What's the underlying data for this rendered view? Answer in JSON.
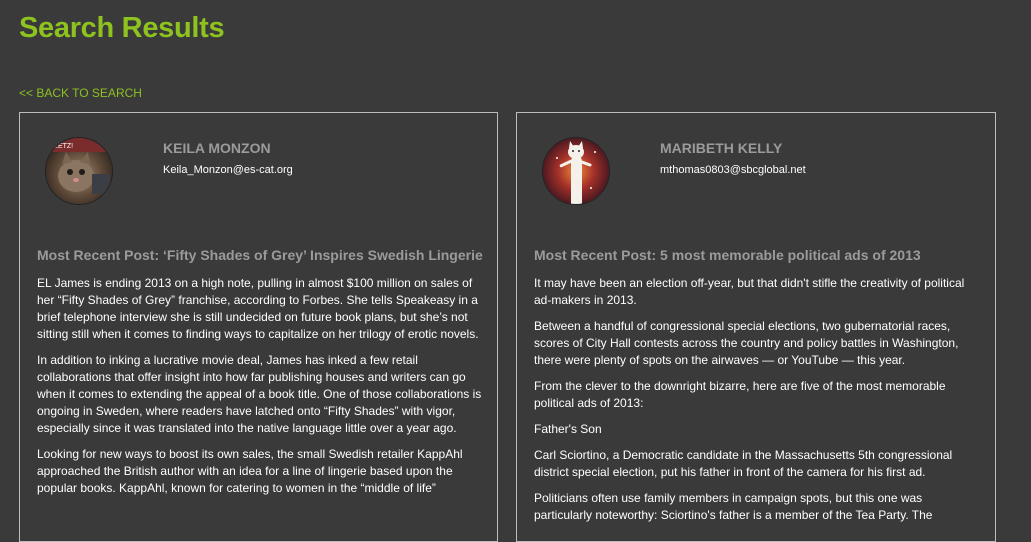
{
  "page": {
    "title": "Search Results",
    "back_label": "<< BACK TO SEARCH"
  },
  "colors": {
    "accent": "#8dc21f",
    "background": "#3a3a3b",
    "muted": "#9b9b9b",
    "border": "#bdbdbd"
  },
  "results": [
    {
      "name": "KEILA MONZON",
      "email": "Keila_Monzon@es-cat.org",
      "avatar_icon": "kitten-avatar",
      "post_title": "Most Recent Post: ‘Fifty Shades of Grey’ Inspires Swedish Lingerie",
      "paragraphs": [
        "EL James is ending 2013 on a high note, pulling in almost $100 million on sales of her “Fifty Shades of Grey” franchise, according to Forbes. She tells Speakeasy in a brief telephone interview she is still undecided on future book plans, but she’s not sitting still when it comes to finding ways to capitalize on her trilogy of erotic novels.",
        "In addition to inking a lucrative movie deal, James has inked a few retail collaborations that offer insight into how far publishing houses and writers can go when it comes to extending the appeal of a book title. One of those collaborations is ongoing in Sweden, where readers have latched onto “Fifty Shades” with vigor, especially since it was translated into the native language little over a year ago.",
        "Looking for new ways to boost its own sales, the small Swedish retailer KappAhl approached the British author with an idea for a line of lingerie based upon the popular books. KappAhl, known for catering to women in the “middle of life”"
      ]
    },
    {
      "name": "MARIBETH KELLY",
      "email": "mthomas0803@sbcglobal.net",
      "avatar_icon": "longcat-avatar",
      "post_title": "Most Recent Post: 5 most memorable political ads of 2013",
      "paragraphs": [
        "It may have been an election off-year, but that didn't stifle the creativity of political ad-makers in 2013.",
        "Between a handful of congressional special elections, two gubernatorial races, scores of City Hall contests across the country and policy battles in Washington, there were plenty of spots on the airwaves — or YouTube — this year.",
        "From the clever to the downright bizarre, here are five of the most memorable political ads of 2013:",
        "Father's Son",
        "Carl Sciortino, a Democratic candidate in the Massachusetts 5th congressional district special election, put his father in front of the camera for his first ad.",
        "Politicians often use family members in campaign spots, but this one was particularly noteworthy: Sciortino's father is a member of the Tea Party. The"
      ]
    }
  ]
}
